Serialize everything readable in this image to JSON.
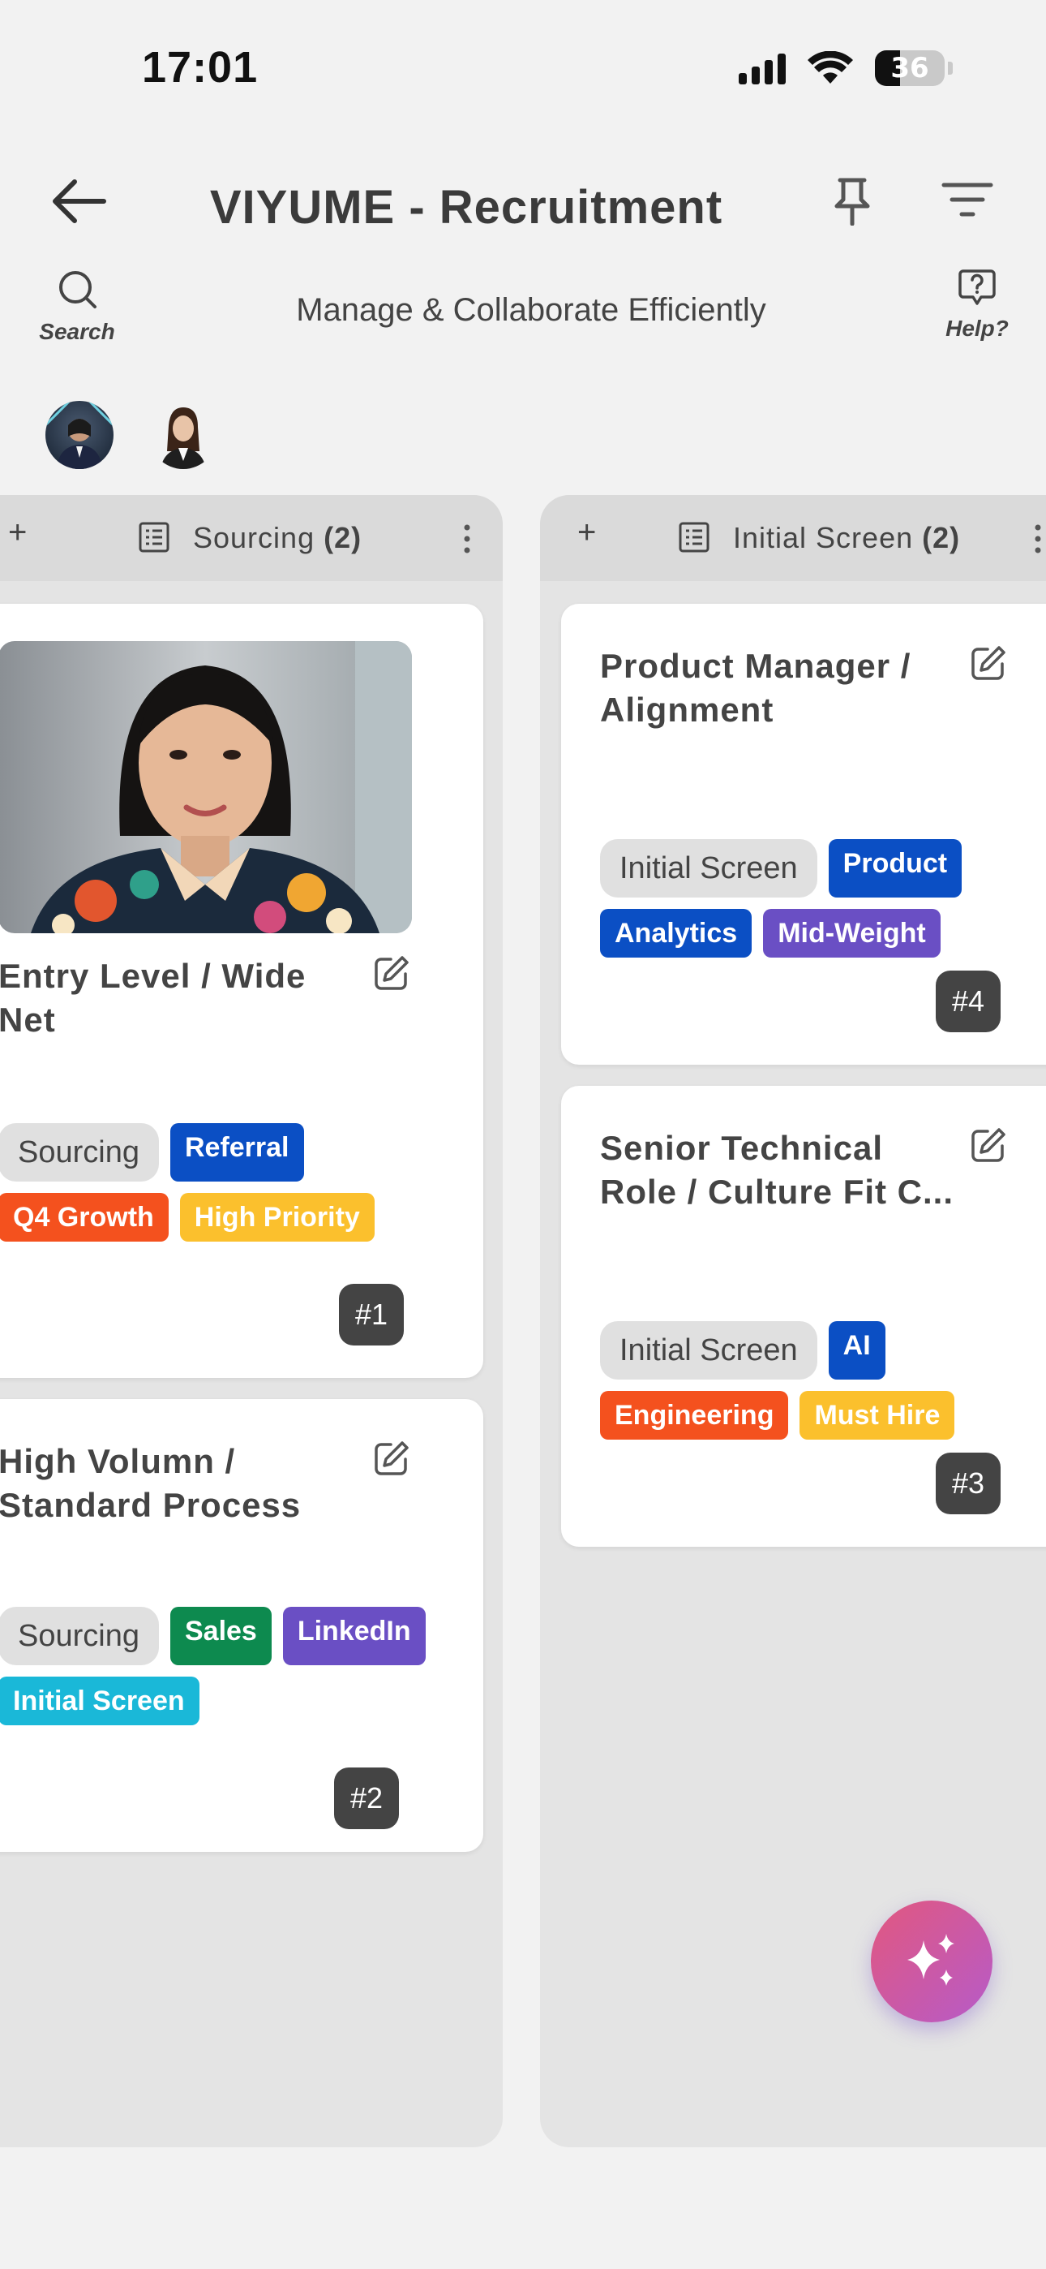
{
  "status_bar": {
    "time": "17:01",
    "battery": "36",
    "battery_level": 0.36
  },
  "header": {
    "title": "VIYUME - Recruitment",
    "subtitle": "Manage & Collaborate Efficiently",
    "search_label": "Search",
    "help_label": "Help?"
  },
  "columns": [
    {
      "name": "Sourcing",
      "count": "(2)",
      "add_label": "+",
      "cards": [
        {
          "title": "Entry Level / Wide Net",
          "has_photo": true,
          "status_tag": "Sourcing",
          "tags": [
            {
              "label": "Referral",
              "color": "#0b4fc4"
            },
            {
              "label": "Q4 Growth",
              "color": "#f4511e"
            },
            {
              "label": "High Priority",
              "color": "#fbc02d"
            }
          ],
          "number": "#1"
        },
        {
          "title": "High Volumn / Standard Process",
          "has_photo": false,
          "status_tag": "Sourcing",
          "tags": [
            {
              "label": "Sales",
              "color": "#0d8a4f"
            },
            {
              "label": "LinkedIn",
              "color": "#6a4fc4"
            },
            {
              "label": "Initial Screen",
              "color": "#1ab8d8"
            }
          ],
          "number": "#2"
        }
      ]
    },
    {
      "name": "Initial Screen",
      "count": "(2)",
      "add_label": "+",
      "cards": [
        {
          "title": "Product Manager / Alignment",
          "has_photo": false,
          "status_tag": "Initial Screen",
          "tags": [
            {
              "label": "Product",
              "color": "#0b4fc4"
            },
            {
              "label": "Analytics",
              "color": "#0b4fc4"
            },
            {
              "label": "Mid-Weight",
              "color": "#6a4fc4"
            }
          ],
          "number": "#4"
        },
        {
          "title": "Senior Technical Role / Culture Fit C...",
          "has_photo": false,
          "status_tag": "Initial Screen",
          "tags": [
            {
              "label": "AI",
              "color": "#0b4fc4"
            },
            {
              "label": "Engineering",
              "color": "#f4511e"
            },
            {
              "label": "Must Hire",
              "color": "#fbc02d"
            }
          ],
          "number": "#3"
        }
      ]
    }
  ],
  "colors": {
    "accent_fab_start": "#e2587f",
    "accent_fab_end": "#b65ac9"
  },
  "icons": [
    "back-arrow-icon",
    "pin-icon",
    "filter-icon",
    "search-icon",
    "help-icon",
    "board-icon",
    "more-vertical-icon",
    "edit-icon",
    "sparkle-icon"
  ]
}
